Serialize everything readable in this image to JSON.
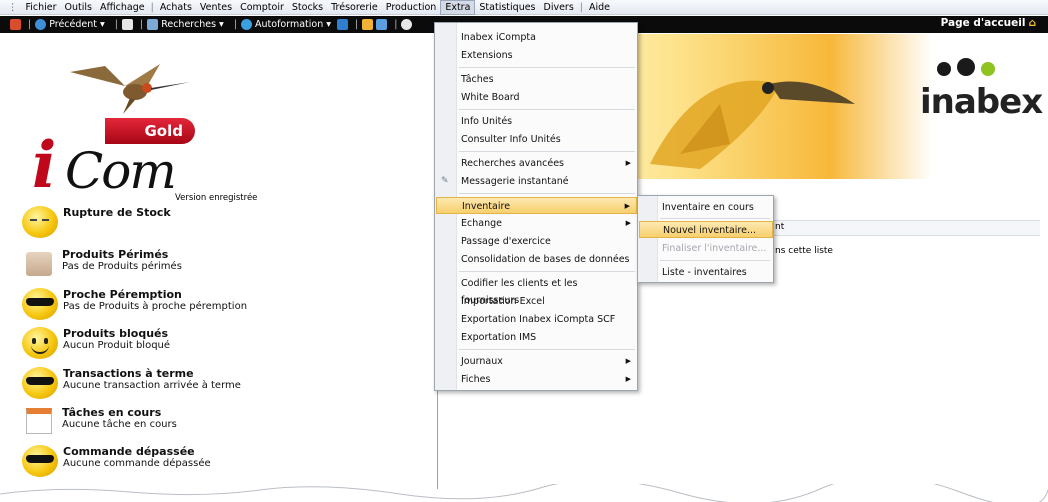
{
  "menubar": {
    "items": [
      "Fichier",
      "Outils",
      "Affichage",
      "Achats",
      "Ventes",
      "Comptoir",
      "Stocks",
      "Trésorerie",
      "Production",
      "Extra",
      "Statistiques",
      "Divers",
      "Aide"
    ],
    "active": "Extra"
  },
  "toolbar": {
    "previous": "Précédent",
    "search": "Recherches",
    "autoformation": "Autoformation",
    "homepage": "Page d'accueil"
  },
  "left": {
    "logo_gold": "Gold",
    "version": "Version enregistrée",
    "alerts": [
      {
        "title": "Rupture de Stock",
        "subtitle": ""
      },
      {
        "title": "Produits Périmés",
        "subtitle": "Pas de Produits périmés"
      },
      {
        "title": "Proche Péremption",
        "subtitle": "Pas de Produits à proche péremption"
      },
      {
        "title": "Produits bloqués",
        "subtitle": "Aucun Produit bloqué"
      },
      {
        "title": "Transactions à terme",
        "subtitle": "Aucune transaction arrivée à  terme"
      },
      {
        "title": "Tâches en cours",
        "subtitle": "Aucune tâche en cours"
      },
      {
        "title": "Commande dépassée",
        "subtitle": "Aucune commande dépassée"
      }
    ]
  },
  "right": {
    "brand": "inabex",
    "column_fragment": "nt",
    "empty_fragment": "ns cette liste"
  },
  "extra_menu": {
    "items": [
      "Inabex iCompta",
      "Extensions",
      "Tâches",
      "White Board",
      "Info Unités",
      "Consulter Info Unités",
      "Recherches avancées",
      "Messagerie instantané",
      "Inventaire",
      "Echange",
      "Passage d'exercice",
      "Consolidation de bases de données",
      "Codifier les clients et les fournisseurs",
      "Importation Excel",
      "Exportation Inabex iCompta SCF",
      "Exportation IMS",
      "Journaux",
      "Fiches"
    ],
    "highlighted": "Inventaire"
  },
  "inventaire_submenu": {
    "items": [
      "Inventaire en cours",
      "Nouvel inventaire...",
      "Finaliser l'inventaire...",
      "Liste - inventaires"
    ],
    "highlighted": "Nouvel inventaire...",
    "disabled": "Finaliser l'inventaire..."
  },
  "colors": {
    "menu_highlight": "#f7cf6d",
    "logo_red": "#c0081d",
    "toolbar_bg": "#0b0b0b"
  }
}
